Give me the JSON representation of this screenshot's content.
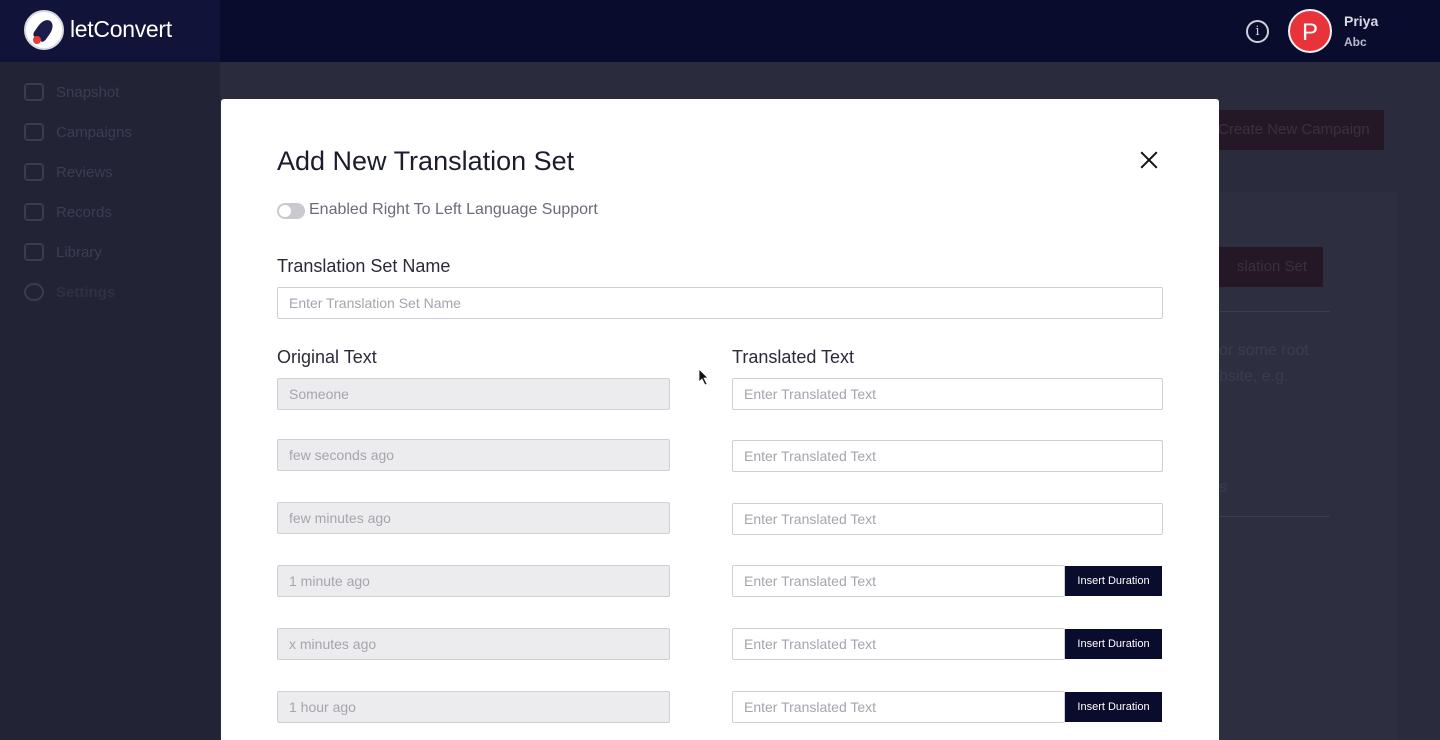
{
  "app": {
    "brand_light": "let",
    "brand_bold": "Convert"
  },
  "header": {
    "info_icon": "info-icon",
    "user": {
      "initial": "P",
      "name": "Priya",
      "org": "Abc"
    },
    "colors": {
      "bar": "#0a0c2e",
      "avatar": "#e8333a"
    }
  },
  "sidebar": {
    "items": [
      {
        "label": "Snapshot",
        "icon": "snapshot-icon"
      },
      {
        "label": "Campaigns",
        "icon": "rocket-icon"
      },
      {
        "label": "Reviews",
        "icon": "star-icon"
      },
      {
        "label": "Records",
        "icon": "list-icon"
      },
      {
        "label": "Library",
        "icon": "grid-icon"
      },
      {
        "label": "Settings",
        "icon": "gear-icon"
      }
    ]
  },
  "background": {
    "create_campaign": "Create New Campaign",
    "new_translation_set": "slation Set",
    "text_line1": "or some root",
    "text_line2": "bsite, e.g.",
    "text_line3": "s"
  },
  "modal": {
    "title": "Add New Translation Set",
    "rtl_toggle_label": "Enabled Right To Left Language Support",
    "rtl_enabled": false,
    "name_label": "Translation Set Name",
    "name_placeholder": "Enter Translation Set Name",
    "original_header": "Original Text",
    "translated_header": "Translated Text",
    "translated_placeholder": "Enter Translated Text",
    "insert_duration_label": "Insert Duration",
    "rows": [
      {
        "original": "Someone",
        "has_duration": false
      },
      {
        "original": "few seconds ago",
        "has_duration": false
      },
      {
        "original": "few minutes ago",
        "has_duration": false
      },
      {
        "original": "1 minute ago",
        "has_duration": true
      },
      {
        "original": "x minutes ago",
        "has_duration": true
      },
      {
        "original": "1 hour ago",
        "has_duration": true
      }
    ]
  }
}
